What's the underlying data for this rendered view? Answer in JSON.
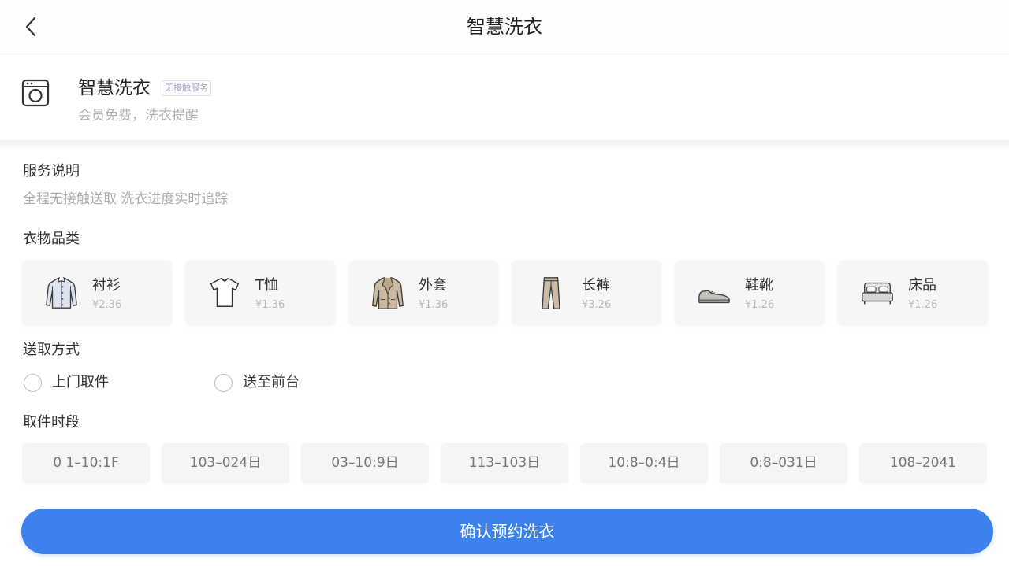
{
  "header": {
    "title": "智慧洗衣",
    "back_icon": "chevron-left-icon"
  },
  "service_card": {
    "icon": "washing-machine-icon",
    "title": "智慧洗衣",
    "tag": "无接触服务",
    "subtitle": "会员免费，洗衣提醒"
  },
  "description": {
    "heading": "服务说明",
    "text": "全程无接触送取 洗衣进度实时追踪"
  },
  "categories": {
    "heading": "衣物品类",
    "items": [
      {
        "name": "衬衫",
        "price": "¥2.36",
        "icon": "shirt-icon"
      },
      {
        "name": "T恤",
        "price": "¥1.36",
        "icon": "tshirt-icon"
      },
      {
        "name": "外套",
        "price": "¥1.36",
        "icon": "jacket-icon"
      },
      {
        "name": "长裤",
        "price": "¥3.26",
        "icon": "pants-icon"
      },
      {
        "name": "鞋靴",
        "price": "¥1.26",
        "icon": "shoe-icon"
      },
      {
        "name": "床品",
        "price": "¥1.26",
        "icon": "bed-icon"
      }
    ]
  },
  "delivery": {
    "heading": "送取方式",
    "options": [
      {
        "label": "上门取件",
        "selected": false
      },
      {
        "label": "送至前台",
        "selected": false
      }
    ]
  },
  "time_slots": {
    "heading": "取件时段",
    "slots": [
      "0 1–10:1F",
      "103–024日",
      "03–10:9日",
      "113–103日",
      "10:8–0:4日",
      "0:8–031日",
      "108–2041"
    ]
  },
  "confirm_button": {
    "label": "确认预约洗衣"
  },
  "colors": {
    "primary": "#3d82ec",
    "card_background": "#f6f6f6",
    "muted_text": "#ababab"
  }
}
